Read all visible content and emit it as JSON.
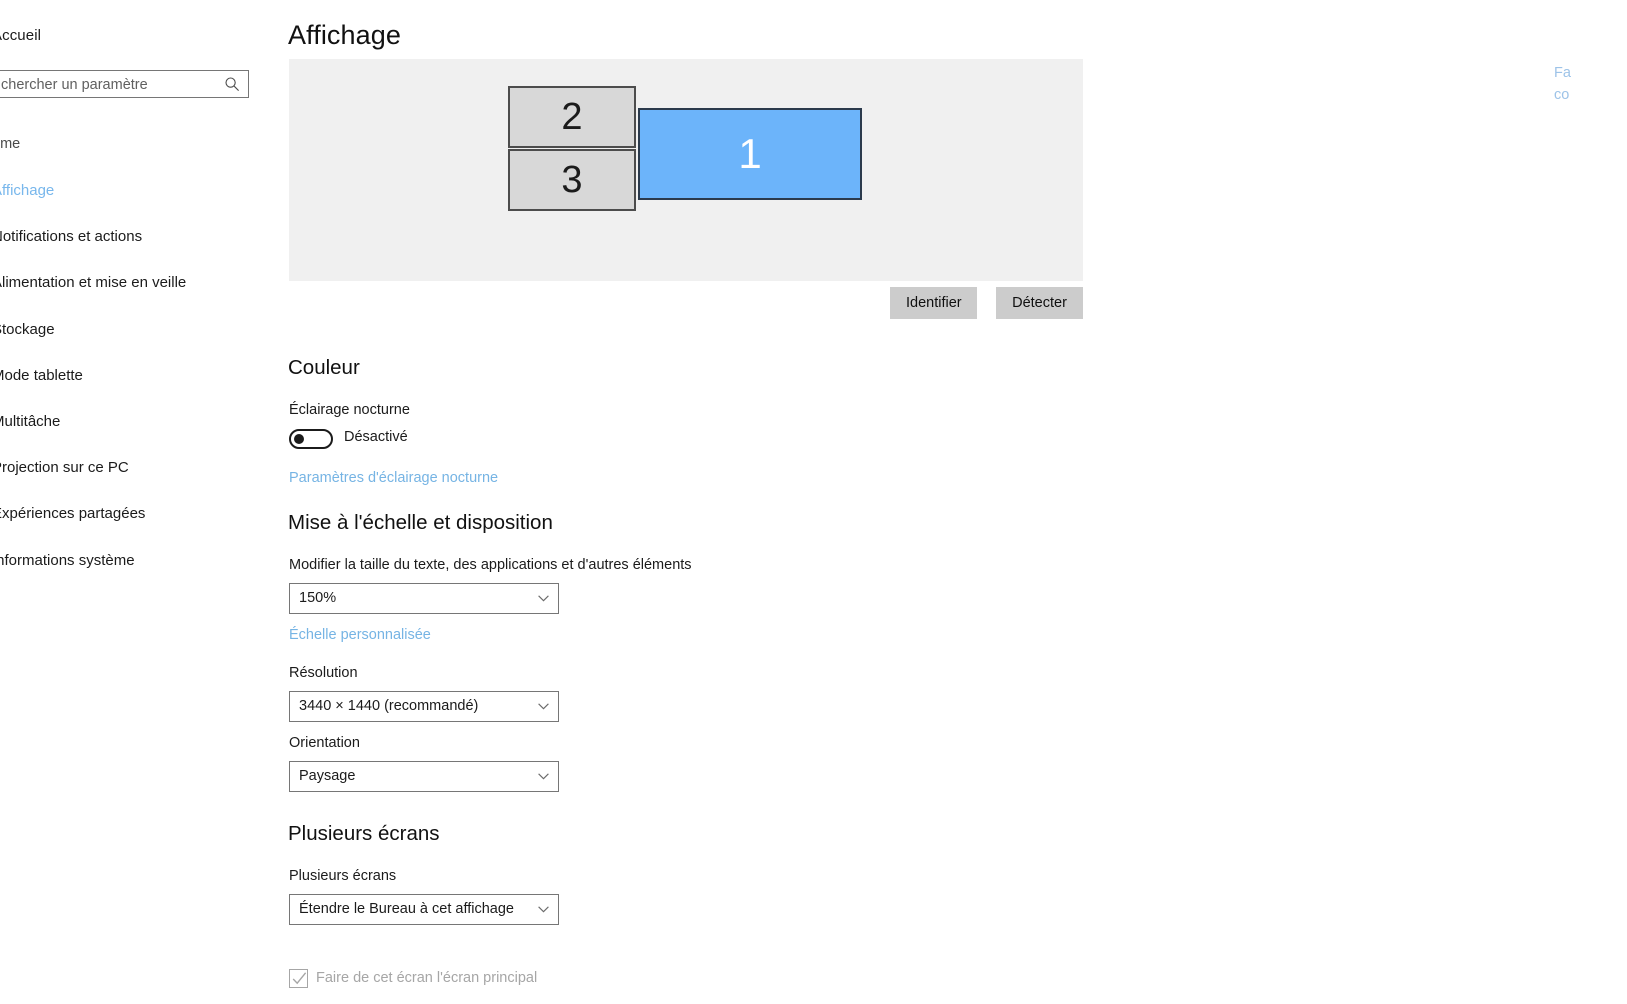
{
  "sidebar": {
    "home_label": "Accueil",
    "search": {
      "placeholder": "chercher un paramètre",
      "value": "",
      "icon": "search-icon"
    },
    "group_title": "ème",
    "items": [
      {
        "label": "Affichage",
        "selected": true
      },
      {
        "label": "Notifications et actions",
        "selected": false
      },
      {
        "label": "Alimentation et mise en veille",
        "selected": false
      },
      {
        "label": "Stockage",
        "selected": false
      },
      {
        "label": "Mode tablette",
        "selected": false
      },
      {
        "label": "Multitâche",
        "selected": false
      },
      {
        "label": "Projection sur ce PC",
        "selected": false
      },
      {
        "label": "Expériences partagées",
        "selected": false
      },
      {
        "label": "Informations système",
        "selected": false
      }
    ]
  },
  "page": {
    "title": "Affichage"
  },
  "preview": {
    "monitors": [
      {
        "number": "2",
        "state": "inactive"
      },
      {
        "number": "3",
        "state": "inactive"
      },
      {
        "number": "1",
        "state": "active"
      }
    ],
    "identify_button": "Identifier",
    "detect_button": "Détecter",
    "background_color": "#f0f0f0",
    "active_color": "#6cb4fa",
    "inactive_color": "#d8d8d8"
  },
  "color_section": {
    "heading": "Couleur",
    "night_light_label": "Éclairage nocturne",
    "night_light_state": "Désactivé",
    "night_light_on": false,
    "settings_link": "Paramètres d'éclairage nocturne"
  },
  "scaling_section": {
    "heading": "Mise à l'échelle et disposition",
    "scale_label": "Modifier la taille du texte, des applications et d'autres éléments",
    "scale_value": "150%",
    "custom_scale_link": "Échelle personnalisée",
    "resolution_label": "Résolution",
    "resolution_value": "3440 × 1440 (recommandé)",
    "orientation_label": "Orientation",
    "orientation_value": "Paysage"
  },
  "multi_display_section": {
    "heading": "Plusieurs écrans",
    "mode_label": "Plusieurs écrans",
    "mode_value": "Étendre le Bureau à cet affichage",
    "main_display_checkbox_label": "Faire de cet écran l'écran principal",
    "main_display_checked": true,
    "main_display_disabled": true
  },
  "right_links": [
    {
      "label": "Fa"
    },
    {
      "label": "co"
    }
  ],
  "accent_color": "#0078d7",
  "link_color": "#76b4e4"
}
